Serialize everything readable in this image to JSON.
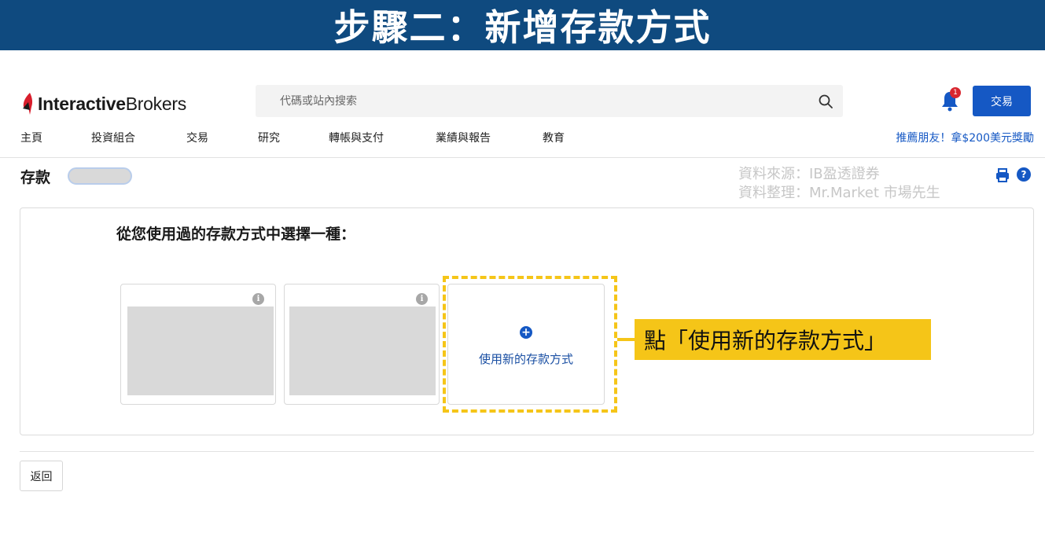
{
  "banner": {
    "title": "步驟二：新增存款方式"
  },
  "header": {
    "logo_bold": "Interactive",
    "logo_regular": "Brokers",
    "search_placeholder": "代碼或站內搜索",
    "notification_count": "1",
    "trade_button": "交易",
    "referral_link": "推薦朋友！拿$200美元獎勵"
  },
  "nav": {
    "items": [
      "主頁",
      "投資組合",
      "交易",
      "研究",
      "轉帳與支付",
      "業績與報告",
      "教育"
    ]
  },
  "page": {
    "title": "存款",
    "source_line1": "資料來源：IB盈透證券",
    "source_line2": "資料整理：Mr.Market 市場先生",
    "prompt": "從您使用過的存款方式中選擇一種：",
    "new_method_label": "使用新的存款方式",
    "callout": "點「使用新的存款方式」",
    "back_button": "返回"
  },
  "colors": {
    "banner": "#0f4a7f",
    "accent": "#1558c4",
    "highlight": "#f5c518",
    "badge": "#d8262f"
  }
}
